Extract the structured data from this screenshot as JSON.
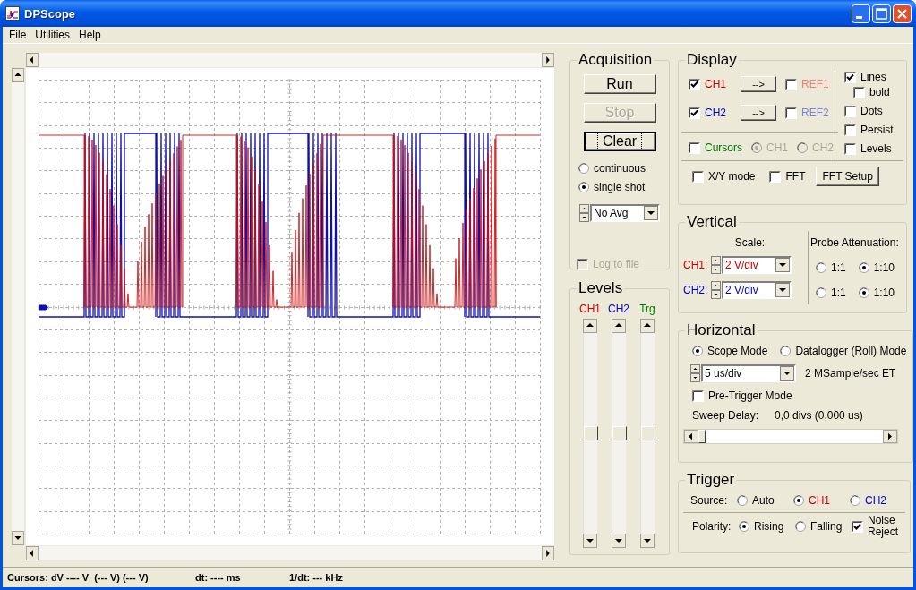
{
  "window": {
    "title": "DPScope"
  },
  "menu": [
    {
      "label": "File"
    },
    {
      "label": "Utilities"
    },
    {
      "label": "Help"
    }
  ],
  "acquisition": {
    "title": "Acquisition",
    "buttons": [
      {
        "label": "Run",
        "disabled": false,
        "focused": false
      },
      {
        "label": "Stop",
        "disabled": true,
        "focused": false
      },
      {
        "label": "Clear",
        "disabled": false,
        "focused": true
      }
    ],
    "modes": [
      {
        "label": "continuous",
        "selected": false
      },
      {
        "label": "single shot",
        "selected": true
      }
    ],
    "averaging": "No Avg",
    "log_to_file": {
      "label": "Log to file",
      "checked": false,
      "disabled": true
    }
  },
  "levels": {
    "title": "Levels",
    "sliders": [
      {
        "label": "CH1",
        "color": "#cc0000",
        "level": 0.5
      },
      {
        "label": "CH2",
        "color": "#0000cc",
        "level": 0.5
      },
      {
        "label": "Trg",
        "color": "#008000",
        "level": 0.5
      }
    ]
  },
  "display": {
    "title": "Display",
    "channels": [
      {
        "label": "CH1",
        "color": "#cc0000",
        "checked": true,
        "button": "-->",
        "ref": {
          "label": "REF1",
          "color": "#f08080",
          "checked": false
        }
      },
      {
        "label": "CH2",
        "color": "#0000cc",
        "checked": true,
        "button": "-->",
        "ref": {
          "label": "REF2",
          "color": "#8080e0",
          "checked": false
        }
      }
    ],
    "cursors": {
      "label": "Cursors",
      "checked": false,
      "channels": [
        {
          "label": "CH1",
          "selected": true,
          "disabled": true
        },
        {
          "label": "CH2",
          "selected": false,
          "disabled": true
        }
      ]
    },
    "options": [
      {
        "label": "Lines",
        "checked": true,
        "children": [
          {
            "label": "bold",
            "checked": false
          }
        ]
      },
      {
        "label": "Dots",
        "checked": false
      },
      {
        "label": "Persist",
        "checked": false
      },
      {
        "label": "Levels",
        "checked": false
      }
    ],
    "xy_mode": {
      "label": "X/Y mode",
      "checked": false
    },
    "fft": {
      "label": "FFT",
      "checked": false
    },
    "fft_setup": "FFT Setup"
  },
  "vertical": {
    "title": "Vertical",
    "scale_label": "Scale:",
    "probe_label": "Probe Attenuation:",
    "channels": [
      {
        "label": "CH1:",
        "color": "#cc0000",
        "scale": "2 V/div",
        "attenuation": [
          {
            "label": "1:1",
            "selected": false
          },
          {
            "label": "1:10",
            "selected": true
          }
        ]
      },
      {
        "label": "CH2:",
        "color": "#0000cc",
        "scale": "2 V/div",
        "attenuation": [
          {
            "label": "1:1",
            "selected": false
          },
          {
            "label": "1:10",
            "selected": true
          }
        ]
      }
    ]
  },
  "horizontal": {
    "title": "Horizontal",
    "modes": [
      {
        "label": "Scope Mode",
        "selected": true
      },
      {
        "label": "Datalogger (Roll) Mode",
        "selected": false
      }
    ],
    "timebase": "5 us/div",
    "sample_rate": "2 MSample/sec ET",
    "pre_trigger": {
      "label": "Pre-Trigger Mode",
      "checked": false
    },
    "sweep_delay_label": "Sweep Delay:",
    "sweep_delay": "0,0 divs (0,000 us)",
    "sweep_slider": {
      "level": 0
    }
  },
  "trigger": {
    "title": "Trigger",
    "source_label": "Source:",
    "sources": [
      {
        "label": "Auto",
        "color": "#000000",
        "selected": false
      },
      {
        "label": "CH1",
        "color": "#cc0000",
        "selected": true
      },
      {
        "label": "CH2",
        "color": "#0000cc",
        "selected": false
      }
    ],
    "polarity_label": "Polarity:",
    "polarities": [
      {
        "label": "Rising",
        "selected": true
      },
      {
        "label": "Falling",
        "selected": false
      }
    ],
    "noise_reject": {
      "label": "Noise Reject",
      "checked": true
    }
  },
  "status_bar": [
    {
      "label": "Cursors: dV ---- V  (--- V) (--- V)"
    },
    {
      "label": "dt: ---- ms"
    },
    {
      "label": "1/dt: --- kHz"
    }
  ]
}
